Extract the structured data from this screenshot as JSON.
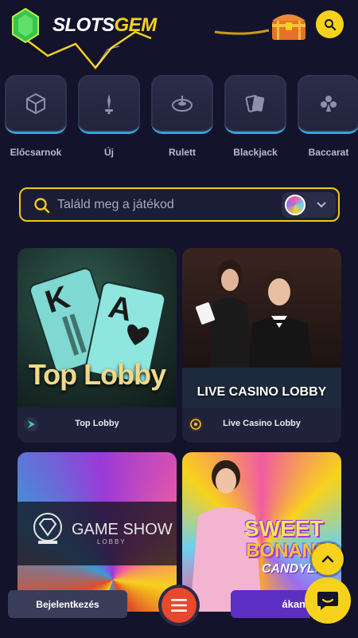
{
  "header": {
    "logo_white": "SLOTS",
    "logo_yellow": "GEM",
    "accent": "#f7d21c"
  },
  "categories": [
    {
      "label": "Előcsarnok",
      "icon": "dice-icon"
    },
    {
      "label": "Új",
      "icon": "new-sparkle-icon"
    },
    {
      "label": "Rulett",
      "icon": "roulette-icon"
    },
    {
      "label": "Blackjack",
      "icon": "cards-icon"
    },
    {
      "label": "Baccarat",
      "icon": "card-suits-icon"
    }
  ],
  "search": {
    "placeholder": "Találd meg a játékod"
  },
  "games": [
    {
      "title": "Top Lobby",
      "overlay": "Top Lobby"
    },
    {
      "title": "Live Casino Lobby",
      "overlay": "LIVE CASINO LOBBY"
    },
    {
      "title": "",
      "overlay": "GAME SHOW",
      "overlay_sub": "LOBBY"
    },
    {
      "title": "",
      "overlay": "SWEET",
      "overlay_2": "BONANZA",
      "overlay_3": "CANDYLA"
    }
  ],
  "bottom": {
    "login_label": "Bejelentkezés",
    "register_label": "ákan"
  }
}
